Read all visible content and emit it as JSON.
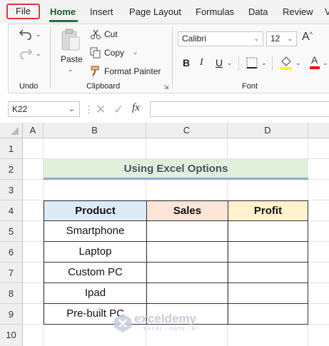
{
  "ribbon_tabs": [
    "File",
    "Home",
    "Insert",
    "Page Layout",
    "Formulas",
    "Data",
    "Review",
    "V"
  ],
  "clipboard": {
    "undo_label": "Undo",
    "paste_label": "Paste",
    "cut_label": "Cut",
    "copy_label": "Copy",
    "format_painter_label": "Format Painter",
    "group_label": "Clipboard"
  },
  "font": {
    "font_name": "Calibri",
    "font_size": "12",
    "bold": "B",
    "italic": "I",
    "underline": "U",
    "group_label": "Font",
    "highlight_color": "#ffff00",
    "font_color": "#ff0000"
  },
  "formula_bar": {
    "name_box": "K22",
    "fx": "fx",
    "formula": ""
  },
  "columns": [
    "A",
    "B",
    "C",
    "D"
  ],
  "rows": [
    "1",
    "2",
    "3",
    "4",
    "5",
    "6",
    "7",
    "8",
    "9",
    "10"
  ],
  "sheet": {
    "title": "Using Excel Options",
    "headers": [
      "Product",
      "Sales",
      "Profit"
    ],
    "header_colors": [
      "#ddebf7",
      "#fce4d6",
      "#fff2cc"
    ],
    "products": [
      "Smartphone",
      "Laptop",
      "Custom PC",
      "Ipad",
      "Pre-built PC"
    ]
  },
  "watermark": {
    "brand": "exceldemy",
    "tagline": "EXCEL · DATA · BI"
  },
  "accent_color": "#1e7145"
}
